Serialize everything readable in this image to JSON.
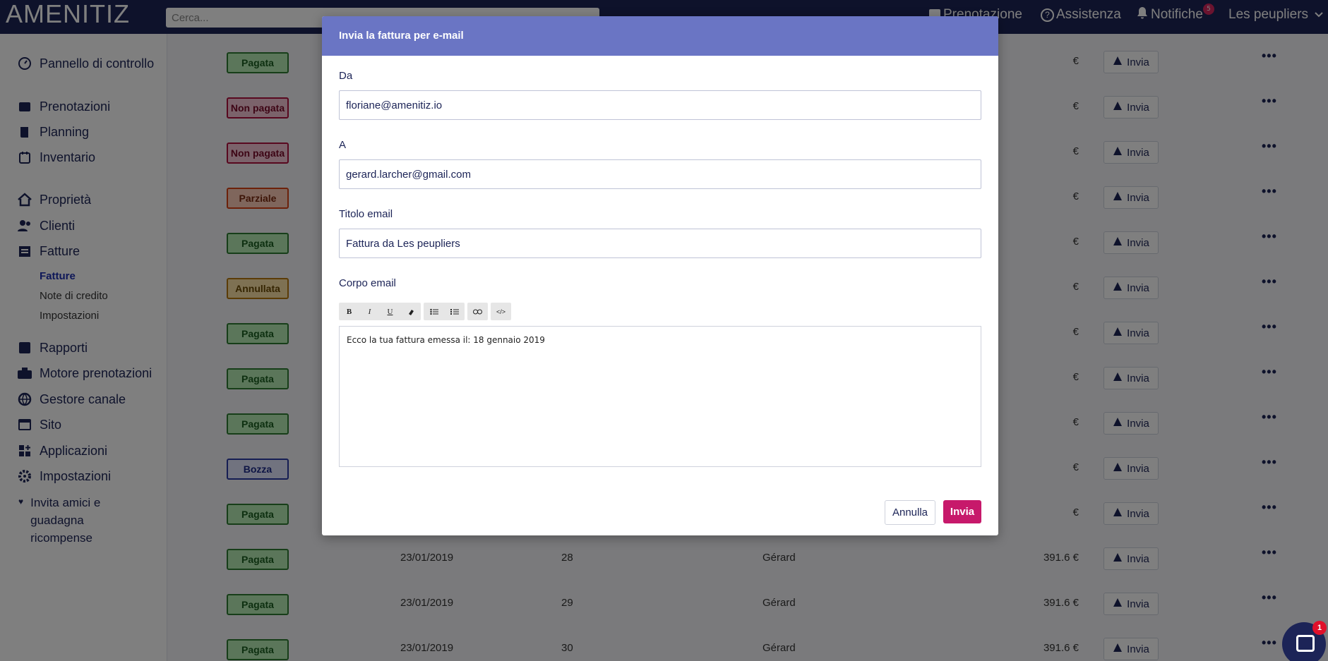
{
  "app": {
    "logo": "AMENITIZ"
  },
  "search": {
    "placeholder": "Cerca..."
  },
  "topnav": {
    "booking": "Prenotazione",
    "help": "Assistenza",
    "notifications": "Notifiche",
    "notification_count": "5",
    "property": "Les peupliers"
  },
  "sidebar": {
    "dashboard": "Pannello di controllo",
    "bookings": "Prenotazioni",
    "planning": "Planning",
    "inventory": "Inventario",
    "property": "Proprietà",
    "clients": "Clienti",
    "invoices": "Fatture",
    "sub_invoices": "Fatture",
    "sub_credit_notes": "Note di credito",
    "sub_settings": "Impostazioni",
    "reports": "Rapporti",
    "booking_engine": "Motore prenotazioni",
    "channel_manager": "Gestore canale",
    "site": "Sito",
    "apps": "Applicazioni",
    "settings": "Impostazioni",
    "invite": "Invita amici e guadagna ricompense"
  },
  "table": {
    "send_label": "Invia",
    "rows": [
      {
        "status": "Pagata",
        "kind": "paid",
        "date": "",
        "num": "",
        "client": "",
        "amount": "€"
      },
      {
        "status": "Non pagata",
        "kind": "unpaid",
        "date": "",
        "num": "",
        "client": "",
        "amount": "€"
      },
      {
        "status": "Non pagata",
        "kind": "unpaid",
        "date": "",
        "num": "",
        "client": "",
        "amount": "€"
      },
      {
        "status": "Parziale",
        "kind": "partial",
        "date": "",
        "num": "",
        "client": "",
        "amount": "€"
      },
      {
        "status": "Pagata",
        "kind": "paid",
        "date": "",
        "num": "",
        "client": "",
        "amount": "€"
      },
      {
        "status": "Annullata",
        "kind": "cancelled",
        "date": "",
        "num": "",
        "client": "",
        "amount": "€"
      },
      {
        "status": "Pagata",
        "kind": "paid",
        "date": "",
        "num": "",
        "client": "",
        "amount": "€"
      },
      {
        "status": "Pagata",
        "kind": "paid",
        "date": "",
        "num": "",
        "client": "",
        "amount": "€"
      },
      {
        "status": "Pagata",
        "kind": "paid",
        "date": "",
        "num": "",
        "client": "",
        "amount": "€"
      },
      {
        "status": "Bozza",
        "kind": "draft",
        "date": "",
        "num": "",
        "client": "",
        "amount": "€"
      },
      {
        "status": "Pagata",
        "kind": "paid",
        "date": "",
        "num": "",
        "client": "",
        "amount": "€"
      },
      {
        "status": "Pagata",
        "kind": "paid",
        "date": "23/01/2019",
        "num": "28",
        "client": "Gérard",
        "amount": "391.6 €"
      },
      {
        "status": "Pagata",
        "kind": "paid",
        "date": "23/01/2019",
        "num": "29",
        "client": "Gérard",
        "amount": "391.6 €"
      },
      {
        "status": "Pagata",
        "kind": "paid",
        "date": "23/01/2019",
        "num": "30",
        "client": "Gérard",
        "amount": "391.6 €"
      }
    ]
  },
  "modal": {
    "title": "Invia la fattura per e-mail",
    "from_label": "Da",
    "from_value": "floriane@amenitiz.io",
    "to_label": "A",
    "to_value": "gerard.larcher@gmail.com",
    "subject_label": "Titolo email",
    "subject_value": "Fattura da Les peupliers",
    "body_label": "Corpo email",
    "body_text": "Ecco la tua fattura emessa il: 18 gennaio 2019",
    "cancel": "Annulla",
    "send": "Invia"
  },
  "chat": {
    "badge": "1"
  },
  "colors": {
    "brand": "#1c2457",
    "accent": "#c7196b",
    "modal_header": "#6a75c4"
  }
}
